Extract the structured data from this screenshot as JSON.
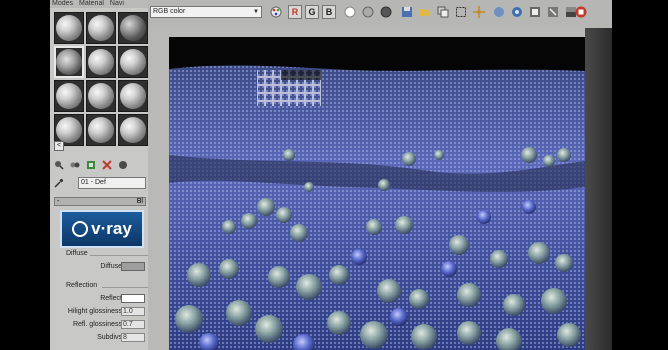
{
  "material_editor": {
    "menu": [
      "Modes",
      "Material",
      "Navi"
    ],
    "material_name": "01 - Def",
    "rollout_title": "Bl",
    "collapse_symbol": "-",
    "scroll_symbol": "<",
    "brand": "v·ray",
    "diffuse_group": "Diffuse",
    "diffuse_label": "Diffuse",
    "diffuse_color": "#9e9e9e",
    "reflection_group": "Reflection",
    "reflect_label": "Reflect",
    "reflect_color": "#ffffff",
    "hilight_label": "Hilight glossiness",
    "hilight_value": "1.0",
    "refl_gloss_label": "Refl. glossiness",
    "refl_gloss_value": "0.7",
    "subdivs_label": "Subdivs",
    "subdivs_value": "8"
  },
  "frame_buffer": {
    "channel": "RGB color",
    "r_label": "R",
    "g_label": "G",
    "b_label": "B",
    "red_color": "#c0392b",
    "toolbar_icons": [
      "color-palette-icon",
      "red-channel-icon",
      "green-channel-icon",
      "blue-channel-icon",
      "white-dot-icon",
      "gray-dot-icon",
      "dark-dot-icon",
      "save-icon",
      "open-folder-icon",
      "copy-icon",
      "region-render-icon",
      "tracking-icon",
      "pan-icon",
      "zoom-icon",
      "swatch-icon",
      "clear-icon",
      "lut-icon",
      "stop-render-icon"
    ]
  }
}
